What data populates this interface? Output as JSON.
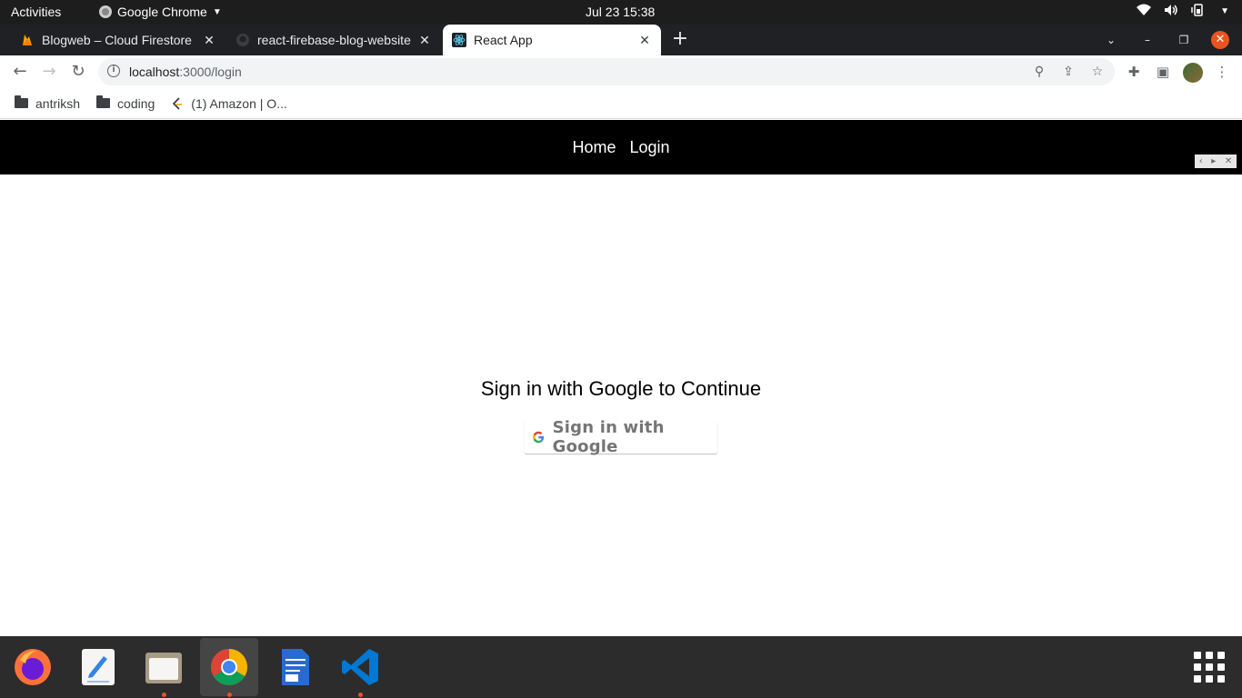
{
  "system_bar": {
    "activities": "Activities",
    "app_name": "Google Chrome",
    "clock": "Jul 23  15:38"
  },
  "browser": {
    "tabs": [
      {
        "title": "Blogweb – Cloud Firestore",
        "icon": "firebase-icon",
        "active": false
      },
      {
        "title": "react-firebase-blog-website",
        "icon": "github-icon",
        "active": false
      },
      {
        "title": "React App",
        "icon": "react-icon",
        "active": true
      }
    ],
    "url_host": "localhost",
    "url_path": ":3000/login",
    "bookmarks": [
      {
        "label": "antriksh",
        "icon": "folder-icon"
      },
      {
        "label": "coding",
        "icon": "folder-icon"
      },
      {
        "label": "(1) Amazon | O...",
        "icon": "leetcode-icon"
      }
    ]
  },
  "page": {
    "nav": {
      "home": "Home",
      "login": "Login"
    },
    "heading": "Sign in with Google to Continue",
    "google_button": "Sign in with Google"
  },
  "dock": {
    "apps": [
      "firefox-icon",
      "text-editor-icon",
      "files-icon",
      "chrome-icon",
      "libreoffice-writer-icon",
      "vscode-icon"
    ]
  },
  "colors": {
    "accent_ubuntu": "#e95420",
    "nav_bg": "#000000",
    "tabstrip_bg": "#202124"
  }
}
